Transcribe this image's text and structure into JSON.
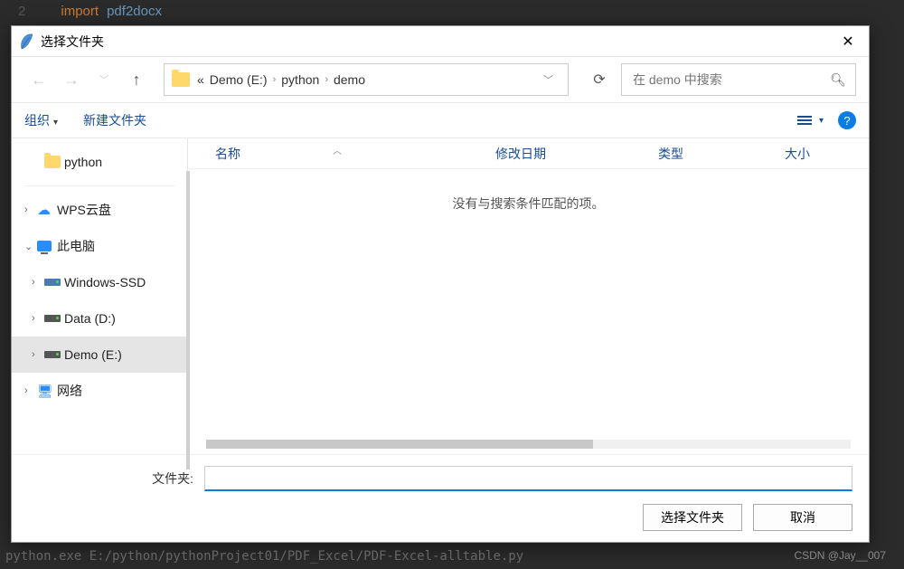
{
  "code": {
    "line_no": "2",
    "keyword": "import",
    "module": "pdf2docx"
  },
  "terminal": "python.exe  E:/python/pythonProject01/PDF_Excel/PDF-Excel-alltable.py",
  "watermark": "CSDN @Jay__007",
  "dialog": {
    "title": "选择文件夹",
    "breadcrumb": {
      "prefix": "«",
      "p1": "Demo (E:)",
      "p2": "python",
      "p3": "demo"
    },
    "search_placeholder": "在 demo 中搜索",
    "toolbar": {
      "organize": "组织",
      "newfolder": "新建文件夹"
    },
    "columns": {
      "name": "名称",
      "modified": "修改日期",
      "type": "类型",
      "size": "大小"
    },
    "empty_msg": "没有与搜索条件匹配的项。",
    "tree": {
      "python": "python",
      "wps": "WPS云盘",
      "thispc": "此电脑",
      "winssd": "Windows-SSD",
      "data": "Data (D:)",
      "demo": "Demo (E:)",
      "network": "网络"
    },
    "folder_label": "文件夹:",
    "folder_value": "",
    "btn_select": "选择文件夹",
    "btn_cancel": "取消"
  }
}
